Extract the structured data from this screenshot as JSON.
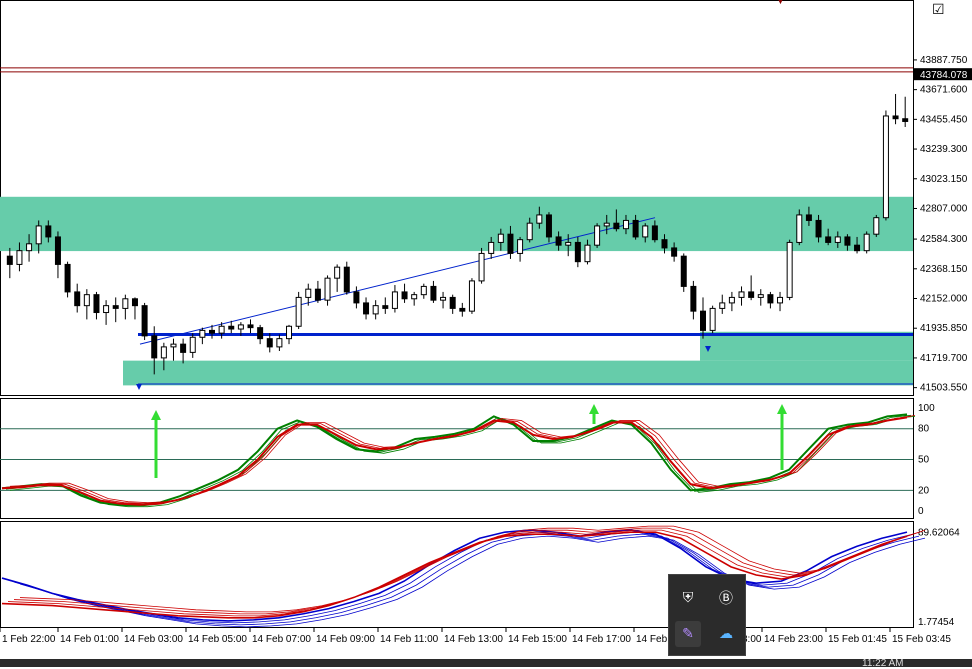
{
  "chart_data": [
    {
      "type": "candlestick",
      "price_ticks": [
        "43887.750",
        "43671.600",
        "43455.450",
        "43239.300",
        "43023.150",
        "42807.000",
        "42584.300",
        "42368.150",
        "42152.000",
        "41935.850",
        "41719.700",
        "41503.550"
      ],
      "price_tick_values": [
        43887.75,
        43671.6,
        43455.45,
        43239.3,
        43023.15,
        42807.0,
        42584.3,
        42368.15,
        42152.0,
        41935.85,
        41719.7,
        41503.55
      ],
      "current_price": "43784.078",
      "ylim": [
        41450,
        44120
      ],
      "candles": [
        [
          42460,
          42520,
          42300,
          42400
        ],
        [
          42400,
          42560,
          42350,
          42500
        ],
        [
          42500,
          42620,
          42420,
          42550
        ],
        [
          42550,
          42720,
          42480,
          42680
        ],
        [
          42680,
          42720,
          42560,
          42600
        ],
        [
          42600,
          42640,
          42300,
          42400
        ],
        [
          42400,
          42420,
          42160,
          42200
        ],
        [
          42200,
          42260,
          42050,
          42100
        ],
        [
          42100,
          42220,
          42000,
          42180
        ],
        [
          42180,
          42200,
          42000,
          42050
        ],
        [
          42050,
          42140,
          41960,
          42100
        ],
        [
          42100,
          42160,
          41980,
          42080
        ],
        [
          42080,
          42180,
          42000,
          42150
        ],
        [
          42150,
          42160,
          42000,
          42100
        ],
        [
          42100,
          42120,
          41850,
          41880
        ],
        [
          41880,
          41950,
          41600,
          41720
        ],
        [
          41720,
          41830,
          41630,
          41800
        ],
        [
          41800,
          41860,
          41700,
          41820
        ],
        [
          41820,
          41860,
          41680,
          41760
        ],
        [
          41760,
          41900,
          41720,
          41870
        ],
        [
          41870,
          41940,
          41820,
          41920
        ],
        [
          41920,
          41960,
          41860,
          41900
        ],
        [
          41900,
          41980,
          41860,
          41950
        ],
        [
          41950,
          41990,
          41900,
          41930
        ],
        [
          41930,
          41980,
          41880,
          41960
        ],
        [
          41960,
          42000,
          41900,
          41940
        ],
        [
          41940,
          41960,
          41820,
          41860
        ],
        [
          41860,
          41900,
          41760,
          41800
        ],
        [
          41800,
          41890,
          41770,
          41860
        ],
        [
          41860,
          41960,
          41820,
          41950
        ],
        [
          41950,
          42200,
          41930,
          42160
        ],
        [
          42160,
          42260,
          42100,
          42220
        ],
        [
          42220,
          42280,
          42120,
          42140
        ],
        [
          42140,
          42320,
          42100,
          42300
        ],
        [
          42300,
          42400,
          42200,
          42380
        ],
        [
          42380,
          42420,
          42180,
          42200
        ],
        [
          42200,
          42240,
          42080,
          42120
        ],
        [
          42120,
          42160,
          42000,
          42040
        ],
        [
          42040,
          42140,
          42000,
          42100
        ],
        [
          42100,
          42160,
          42040,
          42080
        ],
        [
          42080,
          42250,
          42050,
          42200
        ],
        [
          42200,
          42260,
          42120,
          42150
        ],
        [
          42150,
          42200,
          42100,
          42180
        ],
        [
          42180,
          42260,
          42150,
          42240
        ],
        [
          42240,
          42280,
          42120,
          42140
        ],
        [
          42140,
          42200,
          42080,
          42160
        ],
        [
          42160,
          42180,
          42040,
          42080
        ],
        [
          42080,
          42120,
          42020,
          42060
        ],
        [
          42060,
          42300,
          42040,
          42280
        ],
        [
          42280,
          42520,
          42260,
          42480
        ],
        [
          42480,
          42600,
          42440,
          42560
        ],
        [
          42560,
          42660,
          42500,
          42620
        ],
        [
          42620,
          42680,
          42440,
          42480
        ],
        [
          42480,
          42600,
          42420,
          42580
        ],
        [
          42580,
          42740,
          42560,
          42700
        ],
        [
          42700,
          42820,
          42660,
          42760
        ],
        [
          42760,
          42780,
          42560,
          42600
        ],
        [
          42600,
          42640,
          42500,
          42540
        ],
        [
          42540,
          42620,
          42460,
          42560
        ],
        [
          42560,
          42600,
          42380,
          42420
        ],
        [
          42420,
          42580,
          42400,
          42540
        ],
        [
          42540,
          42700,
          42520,
          42680
        ],
        [
          42680,
          42760,
          42620,
          42700
        ],
        [
          42700,
          42800,
          42640,
          42660
        ],
        [
          42660,
          42760,
          42620,
          42720
        ],
        [
          42720,
          42760,
          42580,
          42600
        ],
        [
          42600,
          42700,
          42560,
          42680
        ],
        [
          42680,
          42720,
          42560,
          42580
        ],
        [
          42580,
          42620,
          42480,
          42520
        ],
        [
          42520,
          42560,
          42420,
          42460
        ],
        [
          42460,
          42480,
          42200,
          42240
        ],
        [
          42240,
          42280,
          42000,
          42060
        ],
        [
          42060,
          42160,
          41860,
          41920
        ],
        [
          41920,
          42100,
          41900,
          42080
        ],
        [
          42080,
          42180,
          42040,
          42120
        ],
        [
          42120,
          42200,
          42060,
          42160
        ],
        [
          42160,
          42240,
          42100,
          42200
        ],
        [
          42200,
          42320,
          42140,
          42160
        ],
        [
          42160,
          42220,
          42100,
          42180
        ],
        [
          42180,
          42200,
          42080,
          42120
        ],
        [
          42120,
          42200,
          42060,
          42160
        ],
        [
          42160,
          42580,
          42140,
          42560
        ],
        [
          42560,
          42800,
          42540,
          42760
        ],
        [
          42760,
          42820,
          42680,
          42720
        ],
        [
          42720,
          42760,
          42560,
          42600
        ],
        [
          42600,
          42660,
          42540,
          42560
        ],
        [
          42560,
          42640,
          42520,
          42600
        ],
        [
          42600,
          42620,
          42500,
          42540
        ],
        [
          42540,
          42600,
          42480,
          42500
        ],
        [
          42500,
          42640,
          42480,
          42620
        ],
        [
          42620,
          42760,
          42600,
          42740
        ],
        [
          42740,
          43520,
          42720,
          43480
        ],
        [
          43480,
          43640,
          43420,
          43460
        ],
        [
          43460,
          43620,
          43400,
          43440
        ]
      ],
      "xlabels": [
        "1 Feb 22:00",
        "14 Feb 01:00",
        "14 Feb 03:00",
        "14 Feb 05:00",
        "14 Feb 07:00",
        "14 Feb 09:00",
        "14 Feb 11:00",
        "14 Feb 13:00",
        "14 Feb 15:00",
        "14 Feb 17:00",
        "14 Feb",
        "3:00",
        "14 Feb 23:00",
        "15 Feb 01:45",
        "15 Feb 03:45"
      ],
      "zones": [
        {
          "from": 42497,
          "to": 42892,
          "color": "#66ccaa"
        },
        {
          "from": 41700,
          "to": 41910,
          "color": "#66ccaa"
        },
        {
          "from": 41520,
          "to": 41700,
          "color": "#66ccaa"
        }
      ],
      "support_line": 41890,
      "resistance_line": 43830
    },
    {
      "type": "line",
      "name": "stochastic",
      "ticks": [
        "100",
        "80",
        "50",
        "20",
        "0"
      ],
      "tick_values": [
        100,
        80,
        50,
        20,
        0
      ],
      "levels": [
        80,
        50,
        20
      ],
      "ylim": [
        -5,
        106
      ],
      "colors": [
        "#008000",
        "#cc0000"
      ],
      "series": [
        {
          "values": [
            22,
            24,
            26,
            25,
            15,
            8,
            6,
            6,
            8,
            14,
            22,
            30,
            40,
            58,
            80,
            88,
            82,
            70,
            60,
            58,
            62,
            70,
            72,
            75,
            80,
            92,
            84,
            68,
            68,
            72,
            80,
            88,
            84,
            66,
            40,
            20,
            22,
            26,
            28,
            32,
            40,
            60,
            80,
            84,
            86,
            92,
            94
          ]
        },
        {
          "values": [
            22,
            23,
            25,
            25,
            18,
            10,
            7,
            6,
            7,
            11,
            17,
            25,
            34,
            50,
            72,
            84,
            84,
            74,
            64,
            60,
            61,
            66,
            70,
            73,
            78,
            88,
            86,
            74,
            70,
            72,
            78,
            86,
            86,
            72,
            48,
            26,
            22,
            24,
            27,
            30,
            36,
            54,
            74,
            82,
            84,
            88,
            91
          ]
        }
      ]
    },
    {
      "type": "line",
      "name": "oscillator",
      "ticks": [
        "89.62064",
        "1.77454"
      ],
      "tick_values": [
        89.62064,
        1.77454
      ],
      "ylim": [
        -2,
        97
      ],
      "colors": [
        "#0000cc",
        "#cc0000"
      ],
      "series": [
        {
          "values": [
            45,
            38,
            30,
            24,
            19,
            14,
            10,
            6,
            4,
            3,
            4,
            6,
            10,
            15,
            22,
            30,
            42,
            58,
            72,
            84,
            90,
            92,
            90,
            86,
            90,
            92,
            88,
            74,
            56,
            44,
            40,
            42,
            52,
            66,
            76,
            84,
            90
          ]
        },
        {
          "values": [
            20,
            19,
            18,
            16,
            14,
            12,
            10,
            8,
            7,
            6,
            6,
            8,
            12,
            18,
            26,
            36,
            48,
            60,
            70,
            80,
            86,
            88,
            88,
            86,
            88,
            90,
            90,
            84,
            70,
            56,
            48,
            44,
            48,
            58,
            68,
            78,
            86
          ]
        }
      ]
    }
  ],
  "toolbar": {
    "checkbox_glyph": "☑",
    "triangle": "▼"
  },
  "tray": {
    "icons": [
      "shield-check-icon",
      "b-app-icon",
      "feather-pen-icon",
      "cloud-icon"
    ],
    "glyphs": [
      "⛨",
      "Ⓑ",
      "✎",
      "☁"
    ]
  },
  "clock": "11:22 AM"
}
